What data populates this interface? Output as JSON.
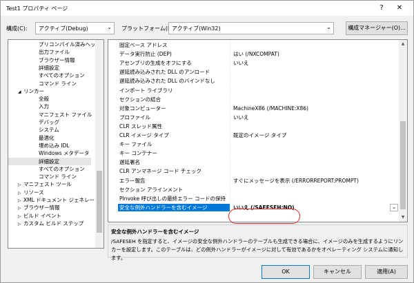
{
  "window": {
    "title": "Test1 プロパティ ページ",
    "help": "?",
    "close": "✕"
  },
  "config": {
    "config_label": "構成(C):",
    "config_value": "アクティブ(Debug)",
    "platform_label": "プラットフォーム(P):",
    "platform_value": "アクティブ(Win32)",
    "manager_button": "構成マネージャー(O)..."
  },
  "tree": {
    "items": [
      {
        "label": "プリコンパイル済みヘッ",
        "indent": 3
      },
      {
        "label": "出力ファイル",
        "indent": 3
      },
      {
        "label": "ブラウザー情報",
        "indent": 3
      },
      {
        "label": "詳細設定",
        "indent": 3
      },
      {
        "label": "すべてのオプション",
        "indent": 3
      },
      {
        "label": "コマンド ライン",
        "indent": 3
      },
      {
        "label": "リンカー",
        "indent": 2,
        "expander": "◢"
      },
      {
        "label": "全般",
        "indent": 3
      },
      {
        "label": "入力",
        "indent": 3
      },
      {
        "label": "マニフェスト ファイル",
        "indent": 3
      },
      {
        "label": "デバッグ",
        "indent": 3
      },
      {
        "label": "システム",
        "indent": 3
      },
      {
        "label": "最適化",
        "indent": 3
      },
      {
        "label": "埋め込み IDL",
        "indent": 3
      },
      {
        "label": "Windows メタデータ",
        "indent": 3
      },
      {
        "label": "詳細設定",
        "indent": 3,
        "selected": true
      },
      {
        "label": "すべてのオプション",
        "indent": 3
      },
      {
        "label": "コマンド ライン",
        "indent": 3
      },
      {
        "label": "マニフェスト ツール",
        "indent": 2,
        "expander": "▷"
      },
      {
        "label": "リソース",
        "indent": 2,
        "expander": "▷"
      },
      {
        "label": "XML ドキュメント ジェネレー",
        "indent": 2,
        "expander": "▷"
      },
      {
        "label": "ブラウザー情報",
        "indent": 2,
        "expander": "▷"
      },
      {
        "label": "ビルド イベント",
        "indent": 2,
        "expander": "▷"
      },
      {
        "label": "カスタム ビルド ステップ",
        "indent": 2,
        "expander": "▷"
      }
    ]
  },
  "grid": {
    "rows": [
      {
        "name": "固定ベース アドレス",
        "value": ""
      },
      {
        "name": "データ実行防止 (DEP)",
        "value": "はい (/NXCOMPAT)"
      },
      {
        "name": "アセンブリの生成をオフにする",
        "value": "いいえ"
      },
      {
        "name": "遅延読み込みされた DLL のアンロード",
        "value": ""
      },
      {
        "name": "遅延読み込みされた DLL のバインドなし",
        "value": ""
      },
      {
        "name": "インポート ライブラリ",
        "value": ""
      },
      {
        "name": "セクションの結合",
        "value": ""
      },
      {
        "name": "対象コンピューター",
        "value": "MachineX86 (/MACHINE:X86)"
      },
      {
        "name": "プロファイル",
        "value": "いいえ"
      },
      {
        "name": "CLR スレッド属性",
        "value": ""
      },
      {
        "name": "CLR イメージ タイプ",
        "value": "既定のイメージ タイプ"
      },
      {
        "name": "キー ファイル",
        "value": ""
      },
      {
        "name": "キー コンテナー",
        "value": ""
      },
      {
        "name": "遅延署名",
        "value": ""
      },
      {
        "name": "CLR アンマネージ コード チェック",
        "value": ""
      },
      {
        "name": "エラー報告",
        "value": "すぐにメッセージを表示 (/ERRORREPORT:PROMPT)"
      },
      {
        "name": "セクション アラインメント",
        "value": ""
      },
      {
        "name": "PInvoke 呼び出しの最終エラー コードの保持",
        "value": ""
      },
      {
        "name": "安全な例外ハンドラーを含むイメージ",
        "value": "いいえ (/SAFESEH:NO)",
        "selected": true
      }
    ]
  },
  "description": {
    "title": "安全な例外ハンドラーを含むイメージ",
    "text": "/SAFESEH を指定すると、イメージの安全な例外ハンドラーのテーブルも生成できる場合に、イメージのみを生成するようにリンカーを設定します。このテーブルは、どの例外ハンドラーがイメージに対して有効であるかをオペレーティング システムに通知します。"
  },
  "buttons": {
    "ok": "OK",
    "cancel": "キャンセル",
    "apply": "適用(A)"
  },
  "icons": {
    "dropdown": "chevron-down-icon",
    "expand": "triangle-right-icon",
    "collapse": "triangle-down-icon"
  }
}
